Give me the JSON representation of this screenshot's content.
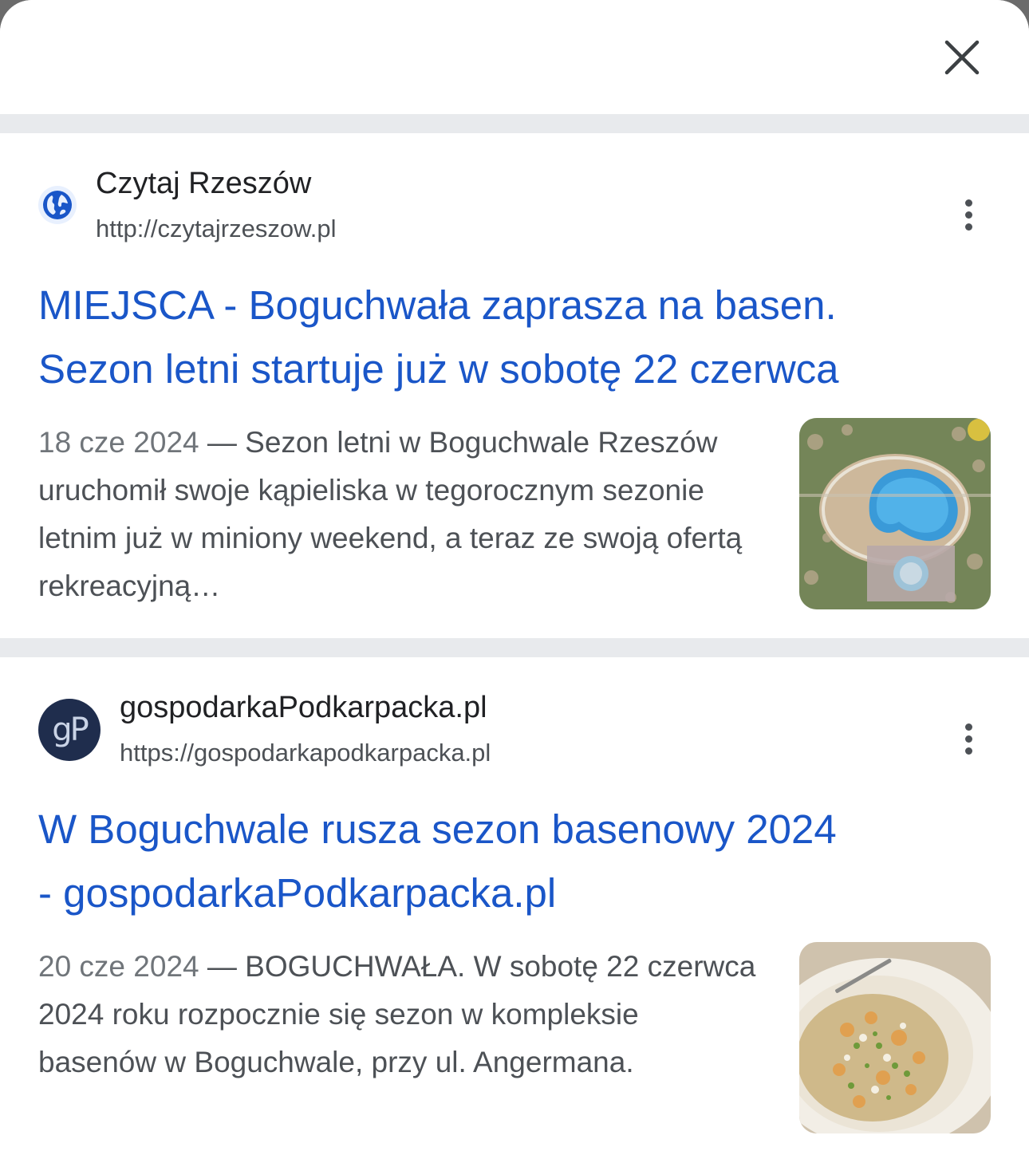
{
  "sheet": {
    "close_icon": "close-icon"
  },
  "results": [
    {
      "site_name": "Czytaj Rzeszów",
      "site_url": "http://czytajrzeszow.pl",
      "favicon": "globe-icon",
      "title_line1": "MIEJSCA - Boguchwała zaprasza na basen.",
      "title_line2": "Sezon letni startuje już w sobotę 22 czerwca",
      "date": "18 cze 2024",
      "separator": " — ",
      "snippet": "Sezon letni w Boguchwale Rzeszów uruchomił swoje kąpieliska w tegorocznym sezonie letnim już w miniony weekend, a teraz ze swoją ofertą rekreacyjną…",
      "thumbnail": "aerial-pool-photo"
    },
    {
      "site_name": "gospodarkaPodkarpacka.pl",
      "site_url": "https://gospodarkapodkarpacka.pl",
      "favicon_text": "gP",
      "title_line1": "W Boguchwale rusza sezon basenowy 2024",
      "title_line2": "- gospodarkaPodkarpacka.pl",
      "date": "20 cze 2024",
      "separator": " — ",
      "snippet": "BOGUCHWAŁA. W sobotę 22 czerwca 2024 roku rozpocznie się sezon w kompleksie basenów w Boguchwale, przy ul. Angermana.",
      "thumbnail": "food-bowl-photo"
    }
  ],
  "colors": {
    "link": "#1a56c8",
    "divider": "#e8eaed",
    "text": "#202124",
    "muted": "#4d5156"
  }
}
